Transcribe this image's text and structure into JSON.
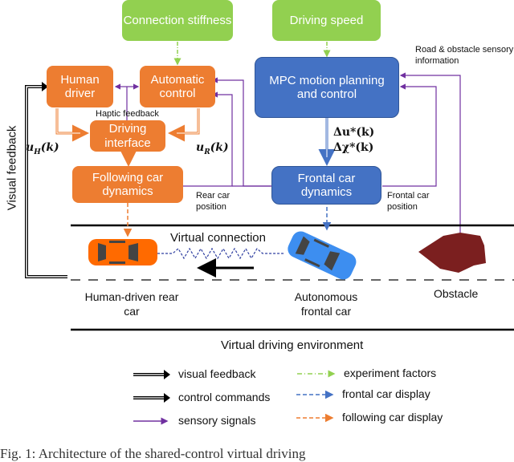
{
  "boxes": {
    "connection_stiffness": "Connection stiffness",
    "driving_speed": "Driving speed",
    "human_driver": "Human driver",
    "automatic_control": "Automatic control",
    "driving_interface": "Driving interface",
    "following_car_dynamics": "Following car dynamics",
    "mpc": "MPC motion planning and control",
    "frontal_car_dynamics": "Frontal car dynamics"
  },
  "labels": {
    "haptic_feedback": "Haptic feedback",
    "visual_feedback": "Visual feedback",
    "road_obstacle_info": "Road & obstacle sensory information",
    "rear_car_position": "Rear car position",
    "frontal_car_position": "Frontal car position",
    "virtual_connection": "Virtual connection",
    "human_driven_rear_car": "Human-driven rear car",
    "autonomous_frontal_car": "Autonomous frontal car",
    "obstacle": "Obstacle",
    "virtual_driving_environment": "Virtual driving environment"
  },
  "math": {
    "u_h": "u",
    "u_h_sub": "H",
    "u_h_arg": "(k)",
    "u_r": "u",
    "u_r_sub": "R",
    "u_r_arg": "(k)",
    "delta_u": "Δu*(k)",
    "delta_chi": "Δχ*(k)"
  },
  "legend": [
    {
      "label": "visual feedback",
      "style": "double-black"
    },
    {
      "label": "control commands",
      "style": "double-black"
    },
    {
      "label": "sensory signals",
      "style": "purple"
    },
    {
      "label": "experiment factors",
      "style": "green-dashdot"
    },
    {
      "label": "frontal car display",
      "style": "blue-dashed"
    },
    {
      "label": "following car display",
      "style": "orange-dashed"
    }
  ],
  "colors": {
    "orange": "#ed7d31",
    "green": "#92d050",
    "blue": "#4472c4",
    "purple": "#7030a0",
    "obstacle": "#7b1f1f",
    "rear_car": "#ff6a00",
    "frontal_car": "#3d8ef0"
  },
  "caption": "Fig. 1: Architecture of the shared-control virtual driving"
}
